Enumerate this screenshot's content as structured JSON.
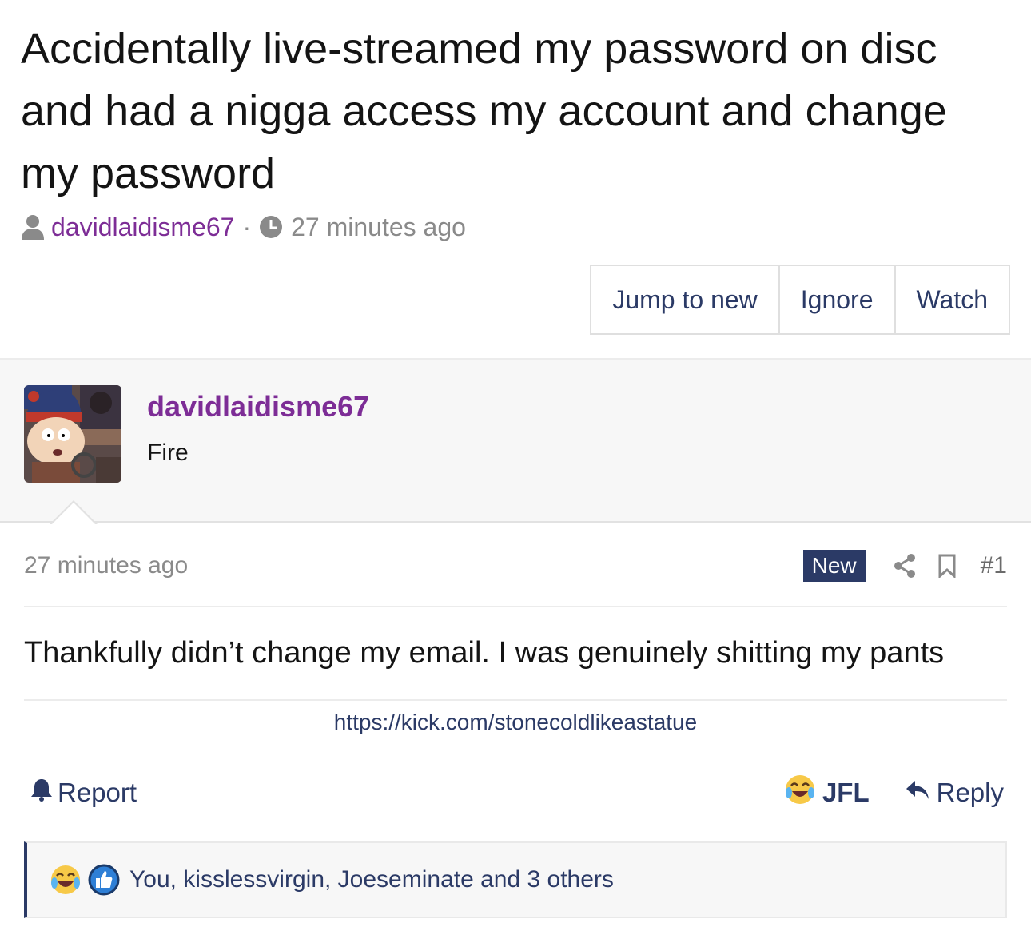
{
  "thread": {
    "title": "Accidentally live-streamed my password on disc and had a nigga access my account and change my password",
    "author": "davidlaidisme67",
    "separator": "·",
    "time": "27 minutes ago"
  },
  "thread_actions": {
    "jump_label": "Jump to new",
    "ignore_label": "Ignore",
    "watch_label": "Watch"
  },
  "post": {
    "username": "davidlaidisme67",
    "user_title": "Fire",
    "time": "27 minutes ago",
    "badge": "New",
    "number": "#1",
    "body": "Thankfully didn’t change my email. I was genuinely shitting my pants",
    "signature": "https://kick.com/stonecoldlikeastatue",
    "report_label": "Report",
    "reaction_label": "JFL",
    "reply_label": "Reply",
    "reactions_summary": "You, kisslessvirgin, Joeseminate and 3 others"
  },
  "icons": {
    "user": "user-icon",
    "clock": "clock-icon",
    "share": "share-icon",
    "bookmark": "bookmark-icon",
    "bell": "bell-icon",
    "reply": "reply-arrow-icon",
    "jfl": "laughing-crying-emoji-icon",
    "like": "thumbs-up-icon"
  },
  "colors": {
    "accent": "#2b3a66",
    "username": "#7d2d96",
    "muted": "#8a8a8a"
  }
}
